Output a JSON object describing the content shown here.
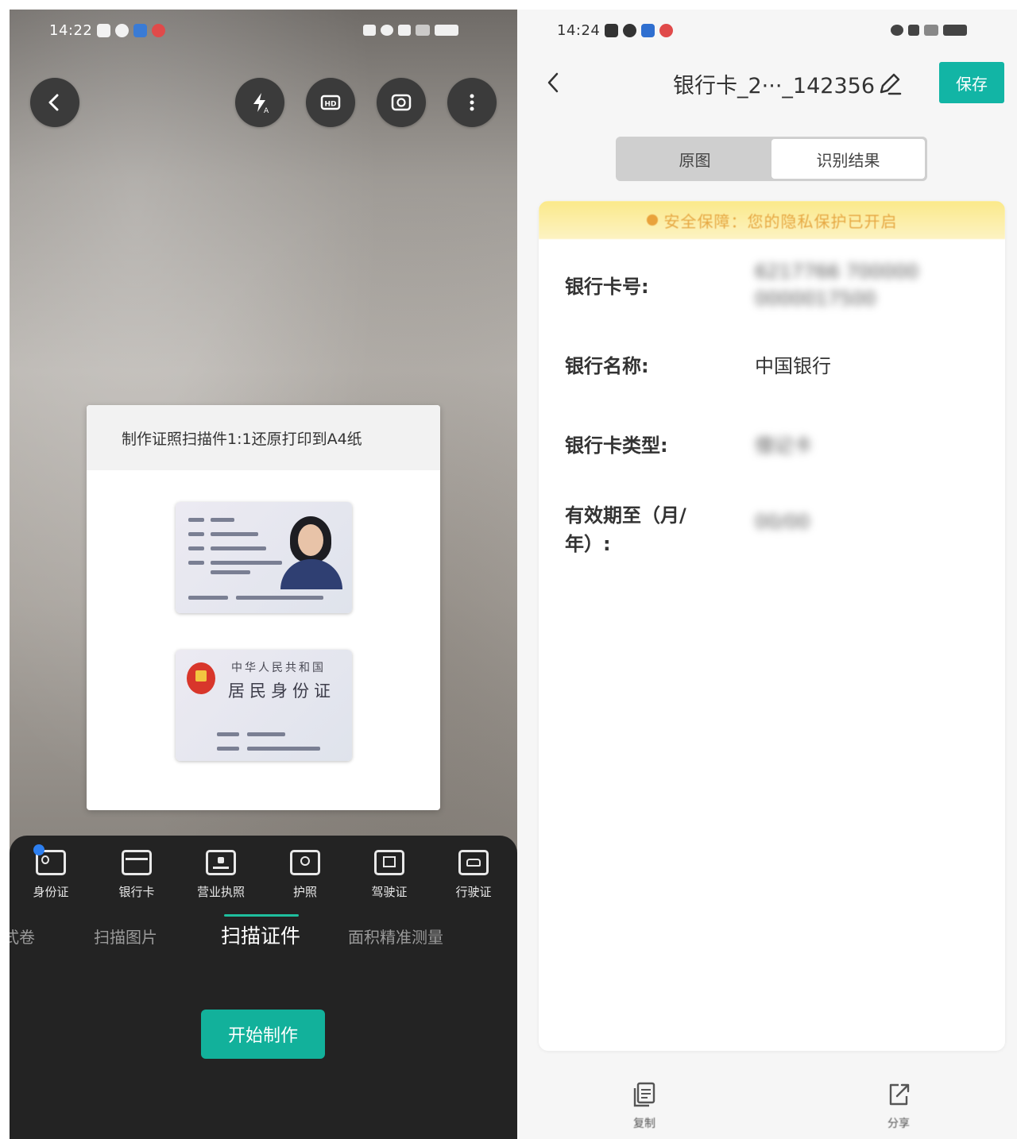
{
  "left": {
    "status_time": "14:22",
    "top_buttons": [
      {
        "icon": "back-arrow-icon"
      },
      {
        "icon": "flash-auto-icon"
      },
      {
        "icon": "hd-icon",
        "label": "HD"
      },
      {
        "icon": "flip-camera-icon"
      },
      {
        "icon": "more-vertical-icon"
      }
    ],
    "template_title": "制作证照扫描件1:1还原打印到A4纸",
    "id_back_title": "中华人民共和国",
    "id_back_subtitle": "居民身份证",
    "doc_types": [
      "身份证",
      "银行卡",
      "营业执照",
      "护照",
      "驾驶证",
      "行驶证"
    ],
    "modes": [
      "式卷",
      "扫描图片",
      "扫描证件",
      "面积精准测量"
    ],
    "start_button": "开始制作"
  },
  "right": {
    "status_time": "14:24",
    "title": "银行卡_2···_142356",
    "save_button": "保存",
    "segments": [
      "原图",
      "识别结果"
    ],
    "privacy_notice": "安全保障：您的隐私保护已开启",
    "fields": [
      {
        "label": "银行卡号:",
        "value": "6217766 7000000000017500",
        "blurred": true
      },
      {
        "label": "银行名称:",
        "value": "中国银行",
        "blurred": false
      },
      {
        "label": "银行卡类型:",
        "value": "借记卡",
        "blurred": true
      },
      {
        "label": "有效期至（月/年）:",
        "value": "00/00",
        "blurred": true
      }
    ],
    "footer": [
      {
        "icon": "copy-icon",
        "label": "复制"
      },
      {
        "icon": "share-icon",
        "label": "分享"
      }
    ]
  }
}
